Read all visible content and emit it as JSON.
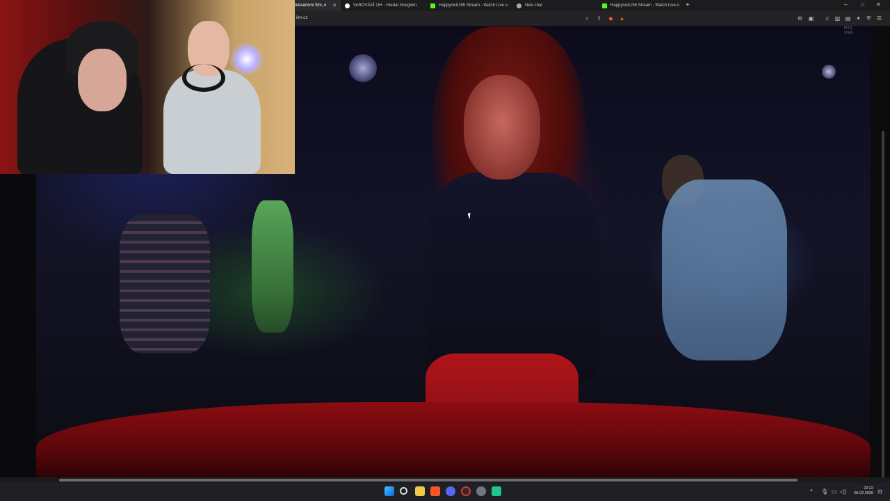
{
  "browser": {
    "tabs": [
      {
        "label": "nteraktivní film, o",
        "favicon": "page-icon",
        "favicon_color": "#3a7bd5",
        "active": true
      },
      {
        "label": "VAROVÁNÍ 18+ - Hledat Googlem",
        "favicon": "google-icon",
        "favicon_color": "#ffffff",
        "active": false
      },
      {
        "label": "Happynick155 Stream - Watch Live o",
        "favicon": "kick-icon",
        "favicon_color": "#53fc18",
        "active": false
      },
      {
        "label": "New chat",
        "favicon": "chat-icon",
        "favicon_color": "#aaaaaa",
        "active": false
      },
      {
        "label": "Happynick155 Stream - Watch Live o",
        "favicon": "kick-icon",
        "favicon_color": "#53fc18",
        "active": false
      }
    ],
    "new_tab": "+",
    "url": "ilm.cz",
    "window_controls": {
      "minimize": "–",
      "maximize": "□",
      "close": "✕"
    }
  },
  "video": {
    "watermark_line1": "RTX",
    "watermark_line2": "VSR"
  },
  "taskbar": {
    "tray_chevron": "^",
    "time": "22:22",
    "date": "06.02.2026"
  },
  "colors": {
    "accent_red": "#b0151a",
    "kick_green": "#53fc18",
    "taskbar_bg": "#1e2025"
  }
}
